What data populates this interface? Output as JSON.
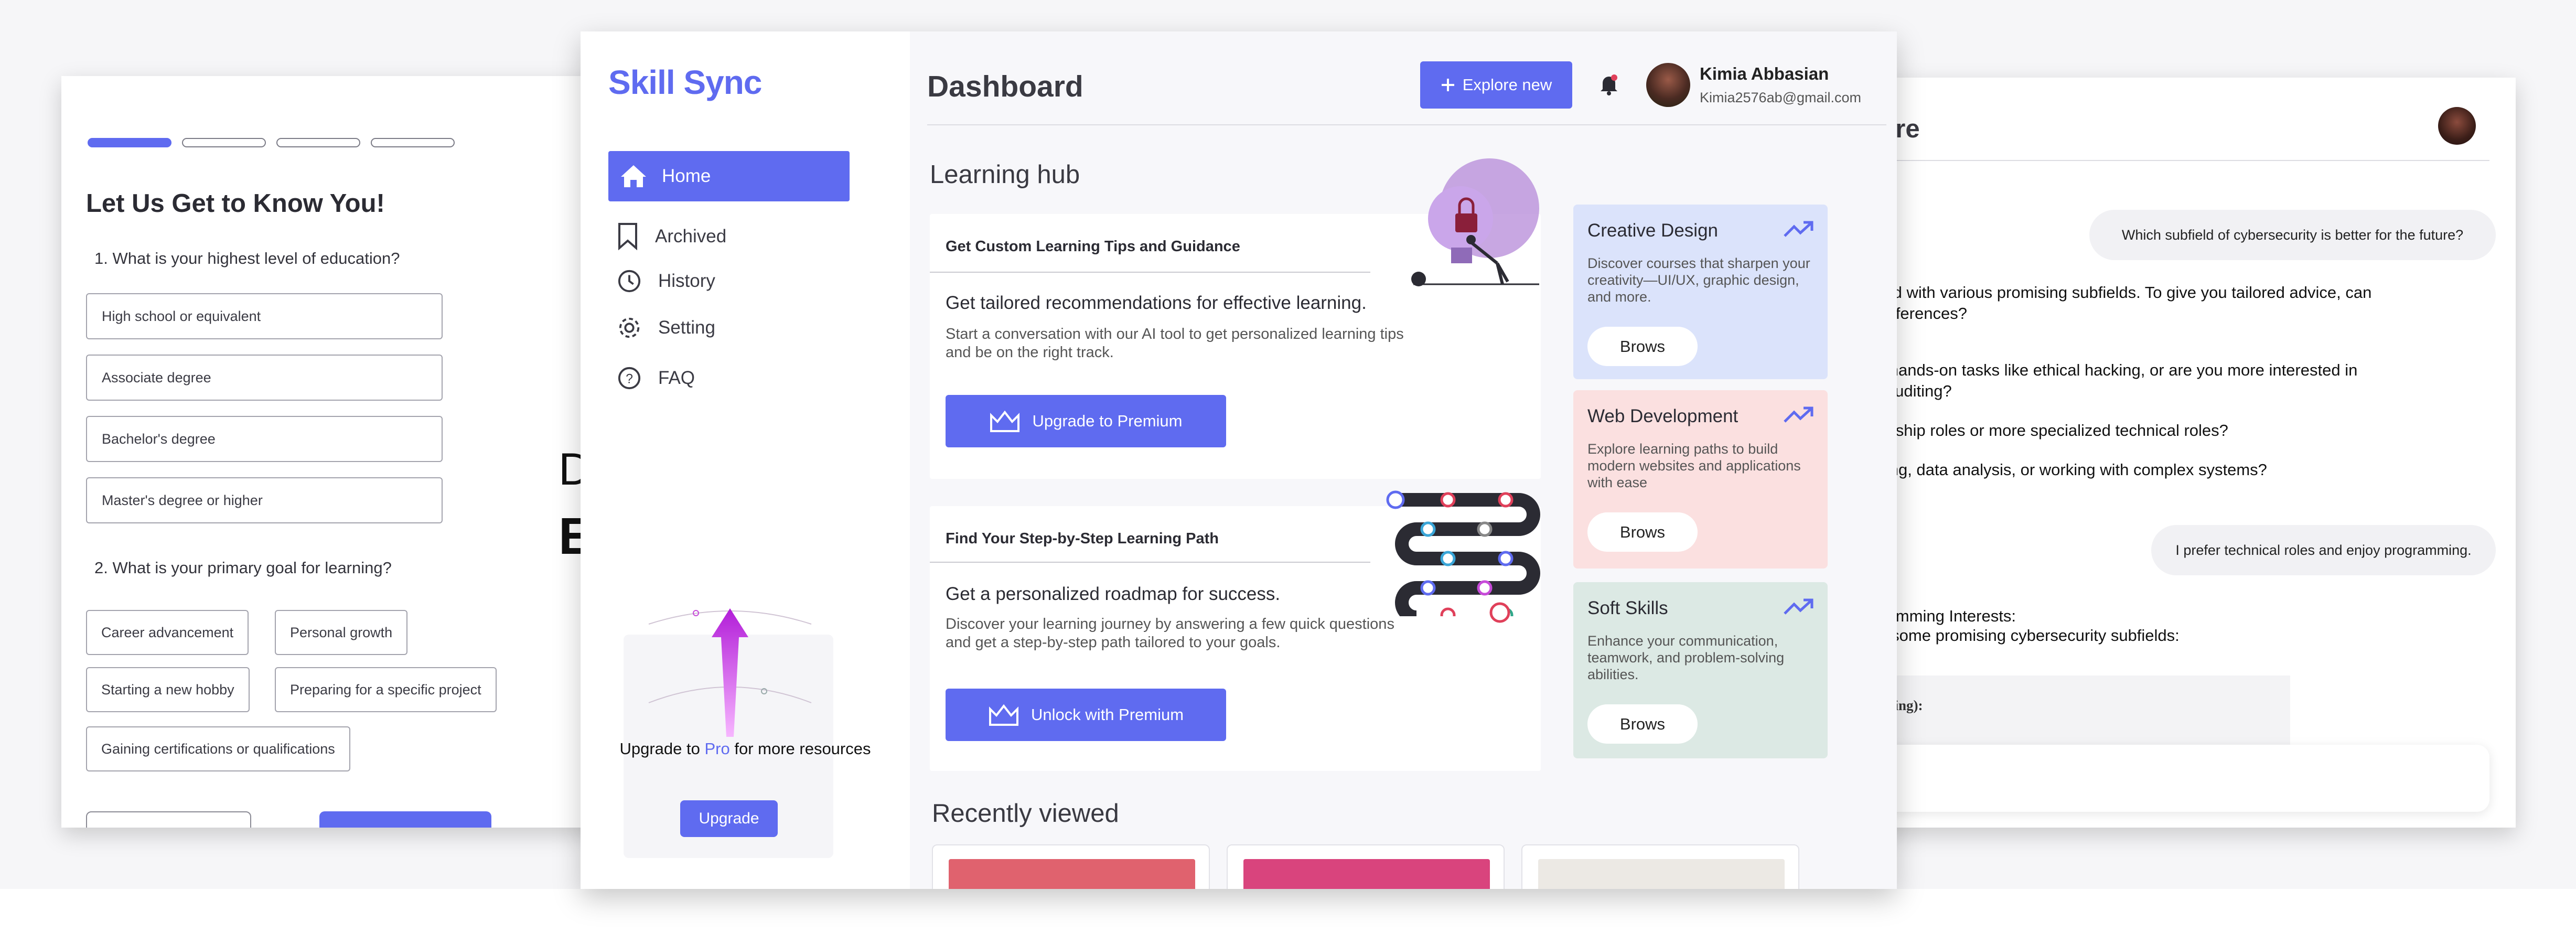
{
  "left_panel": {
    "title": "Let Us Get to Know You!",
    "q1": "1. What is your highest level of education?",
    "education_options": [
      "High school or equivalent",
      "Associate degree",
      "Bachelor's degree",
      "Master's degree or higher"
    ],
    "q2": "2. What is your primary goal for learning?",
    "goal_options": [
      "Career advancement",
      "Personal growth",
      "Starting a new hobby",
      "Preparing for a specific project",
      "Gaining certifications or qualifications"
    ],
    "peek_line1": "D",
    "peek_line2": "E",
    "step_progress": "1 of 4"
  },
  "sidebar": {
    "logo": "Skill Sync",
    "items": [
      {
        "label": "Home",
        "icon": "home-icon",
        "active": true
      },
      {
        "label": "Archived",
        "icon": "bookmark-icon"
      },
      {
        "label": "History",
        "icon": "history-icon"
      },
      {
        "label": "Setting",
        "icon": "gear-icon"
      },
      {
        "label": "FAQ",
        "icon": "help-icon"
      }
    ],
    "promo_text_before": "Upgrade to ",
    "promo_text_pro": "Pro",
    "promo_text_after": " for more resources",
    "promo_button": "Upgrade"
  },
  "header": {
    "title": "Dashboard",
    "explore_button": "Explore new",
    "user_name": "Kimia Abbasian",
    "user_email": "Kimia2576ab@gmail.com"
  },
  "hub": {
    "title": "Learning hub",
    "cards": [
      {
        "heading": "Get Custom Learning Tips and Guidance",
        "subtitle": "Get tailored recommendations for effective learning.",
        "body": "Start a conversation with our AI tool to get personalized learning tips and be on the right track.",
        "button": "Upgrade to Premium"
      },
      {
        "heading": "Find Your Step-by-Step Learning Path",
        "subtitle": "Get a personalized roadmap for success.",
        "body": "Discover your learning journey by answering a few quick questions and get a step-by-step path tailored to your goals.",
        "button": "Unlock with Premium"
      }
    ]
  },
  "courses": [
    {
      "title": "Creative Design",
      "desc": "Discover courses that sharpen your creativity—UI/UX, graphic design, and more.",
      "button": "Brows",
      "color": "#dbe3fb"
    },
    {
      "title": "Web Development",
      "desc": "Explore learning paths to build modern websites and applications with ease",
      "button": "Brows",
      "color": "#fbe0e0"
    },
    {
      "title": "Soft Skills",
      "desc": "Enhance your communication, teamwork, and problem-solving abilities.",
      "button": "Brows",
      "color": "#dce9e4"
    }
  ],
  "recent": {
    "title": "Recently viewed",
    "thumb_colors": [
      "#e0626e",
      "#d9447d",
      "#ece9e4"
    ]
  },
  "chat": {
    "title_partial": "ture",
    "user_msg_1": "Which subfield of cybersecurity is better for the future?",
    "answer_lines": [
      "field with various promising subfields. To give you tailored advice, can",
      " preferences?",
      "al hands-on tasks like ethical hacking, or are you more interested in",
      "d auditing?",
      "dership roles or more specialized technical roles?",
      "ming, data analysis, or working with complex systems?"
    ],
    "user_msg_2": "I prefer technical roles and enjoy programming.",
    "reply_heading": "gramming Interests:",
    "reply_line": "re some promising cybersecurity subfields:",
    "code_label": "acking):"
  },
  "colors": {
    "accent": "#5f6bf0",
    "creative": "#dbe3fb",
    "web": "#fbe0e0",
    "soft": "#dce9e4"
  }
}
